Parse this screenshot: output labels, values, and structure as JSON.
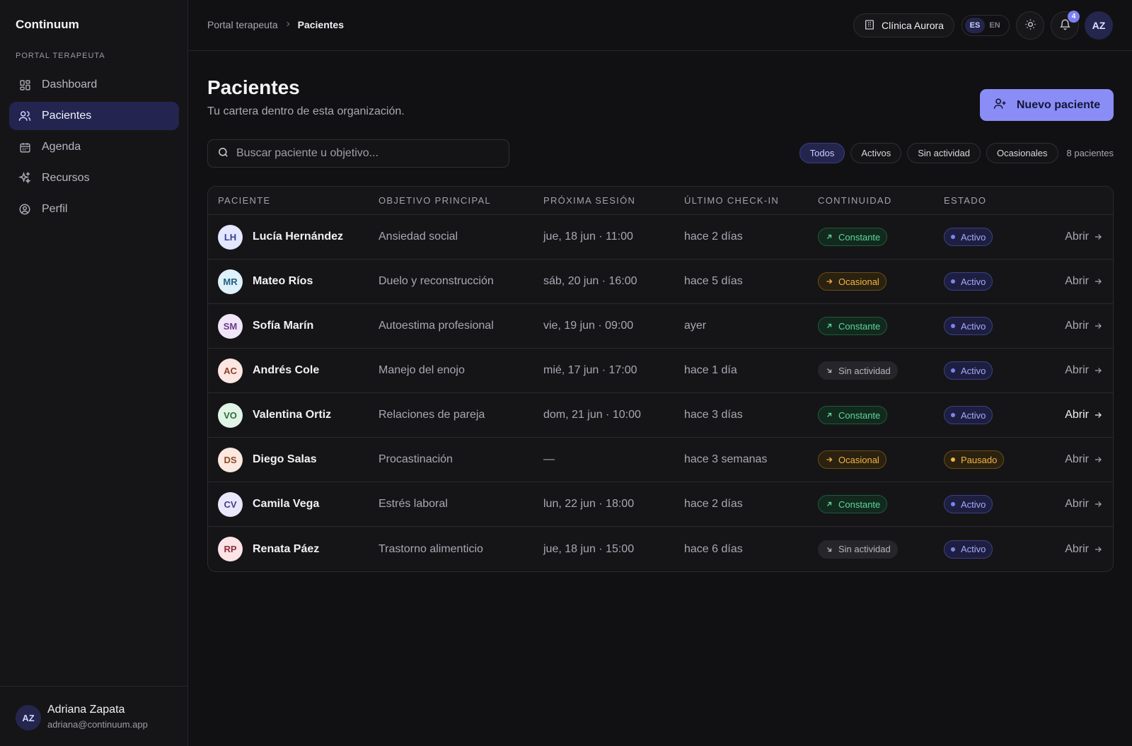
{
  "sidebar": {
    "brand": "Continuum",
    "section_label": "PORTAL TERAPEUTA",
    "items": [
      {
        "label": "Dashboard",
        "icon": "dashboard-icon"
      },
      {
        "label": "Pacientes",
        "icon": "users-icon",
        "active": true
      },
      {
        "label": "Agenda",
        "icon": "calendar-icon"
      },
      {
        "label": "Recursos",
        "icon": "sparkles-icon"
      },
      {
        "label": "Perfil",
        "icon": "user-circle-icon"
      }
    ],
    "user": {
      "initials": "AZ",
      "name": "Adriana Zapata",
      "email": "adriana@continuum.app"
    }
  },
  "topbar": {
    "breadcrumb": {
      "root": "Portal terapeuta",
      "current": "Pacientes"
    },
    "clinic": "Clínica Aurora",
    "lang": {
      "active": "ES",
      "inactive": "EN"
    },
    "notifications_count": "4",
    "avatar_initials": "AZ"
  },
  "main": {
    "title": "Pacientes",
    "subtitle": "Tu cartera dentro de esta organización.",
    "new_button": "Nuevo paciente",
    "search_placeholder": "Buscar paciente u objetivo...",
    "filters": [
      "Todos",
      "Activos",
      "Sin actividad",
      "Ocasionales"
    ],
    "count_label": "8 pacientes"
  },
  "table": {
    "headers": [
      "PACIENTE",
      "OBJETIVO PRINCIPAL",
      "PRÓXIMA SESIÓN",
      "ÚLTIMO CHECK-IN",
      "CONTINUIDAD",
      "ESTADO"
    ],
    "open_label": "Abrir",
    "rows": [
      {
        "initials": "LH",
        "name": "Lucía Hernández",
        "objective": "Ansiedad social",
        "next": "jue, 18 jun · 11:00",
        "checkin": "hace 2 días",
        "continuity": "Constante",
        "state": "Activo",
        "avatar_bg": "#e3e7ff",
        "avatar_fg": "#3a3f8f"
      },
      {
        "initials": "MR",
        "name": "Mateo Ríos",
        "objective": "Duelo y reconstrucción",
        "next": "sáb, 20 jun · 16:00",
        "checkin": "hace 5 días",
        "continuity": "Ocasional",
        "state": "Activo",
        "avatar_bg": "#dff1fb",
        "avatar_fg": "#25607d"
      },
      {
        "initials": "SM",
        "name": "Sofía Marín",
        "objective": "Autoestima profesional",
        "next": "vie, 19 jun · 09:00",
        "checkin": "ayer",
        "continuity": "Constante",
        "state": "Activo",
        "avatar_bg": "#f1e6f9",
        "avatar_fg": "#6b3d86"
      },
      {
        "initials": "AC",
        "name": "Andrés Cole",
        "objective": "Manejo del enojo",
        "next": "mié, 17 jun · 17:00",
        "checkin": "hace 1 día",
        "continuity": "Sin actividad",
        "state": "Activo",
        "avatar_bg": "#fbe6e1",
        "avatar_fg": "#8e3f2d"
      },
      {
        "initials": "VO",
        "name": "Valentina Ortiz",
        "objective": "Relaciones de pareja",
        "next": "dom, 21 jun · 10:00",
        "checkin": "hace 3 días",
        "continuity": "Constante",
        "state": "Activo",
        "avatar_bg": "#e1f5e6",
        "avatar_fg": "#2f6d3f"
      },
      {
        "initials": "DS",
        "name": "Diego Salas",
        "objective": "Procastinación",
        "next": "—",
        "checkin": "hace 3 semanas",
        "continuity": "Ocasional",
        "state": "Pausado",
        "avatar_bg": "#fbe8df",
        "avatar_fg": "#8c4a26"
      },
      {
        "initials": "CV",
        "name": "Camila Vega",
        "objective": "Estrés laboral",
        "next": "lun, 22 jun · 18:00",
        "checkin": "hace 2 días",
        "continuity": "Constante",
        "state": "Activo",
        "avatar_bg": "#e9e7fb",
        "avatar_fg": "#47408a"
      },
      {
        "initials": "RP",
        "name": "Renata Páez",
        "objective": "Trastorno alimenticio",
        "next": "jue, 18 jun · 15:00",
        "checkin": "hace 6 días",
        "continuity": "Sin actividad",
        "state": "Activo",
        "avatar_bg": "#fbe3e6",
        "avatar_fg": "#8a2f3c"
      }
    ]
  },
  "colors": {
    "accent": "#8a8df5",
    "background": "#111113",
    "constant": "#5fd79a",
    "occasional": "#f2b544"
  }
}
